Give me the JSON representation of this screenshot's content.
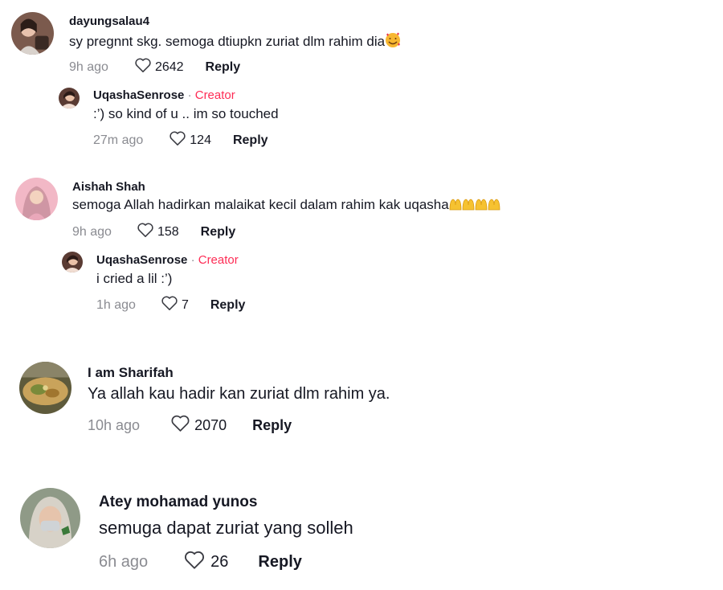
{
  "comments": [
    {
      "username": "dayungsalau4",
      "text": "sy pregnnt skg. semoga dtiupkn zuriat dlm rahim dia",
      "emoji": "smiling-face-with-hearts",
      "time": "9h ago",
      "likes": "2642",
      "reply_label": "Reply"
    },
    {
      "username": "UqashaSenrose",
      "separator": "·",
      "creator_label": "Creator",
      "text": ":’) so kind of u .. im so touched",
      "time": "27m ago",
      "likes": "124",
      "reply_label": "Reply"
    },
    {
      "username": "Aishah Shah",
      "text": "semoga Allah hadirkan malaikat kecil dalam rahim kak uqasha",
      "emoji": "palms-up-together-x4",
      "time": "9h ago",
      "likes": "158",
      "reply_label": "Reply"
    },
    {
      "username": "UqashaSenrose",
      "separator": "·",
      "creator_label": "Creator",
      "text": "i cried a lil :’)",
      "time": "1h ago",
      "likes": "7",
      "reply_label": "Reply"
    },
    {
      "username": "I am Sharifah",
      "text": "Ya allah kau hadir kan zuriat dlm rahim ya.",
      "time": "10h ago",
      "likes": "2070",
      "reply_label": "Reply"
    },
    {
      "username": "Atey mohamad yunos",
      "text": "semuga dapat zuriat yang solleh",
      "time": "6h ago",
      "likes": "26",
      "reply_label": "Reply"
    }
  ],
  "icons": {
    "like": "heart-outline-icon"
  },
  "colors": {
    "text": "#161823",
    "secondary": "#8a8b91",
    "creator": "#fe2c55"
  }
}
